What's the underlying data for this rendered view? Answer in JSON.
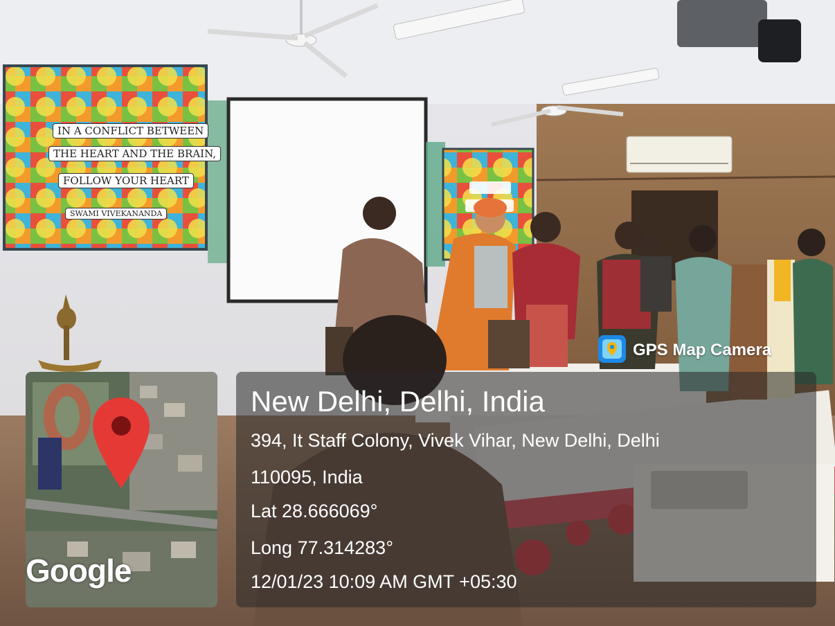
{
  "photo": {
    "poster_left_lines": [
      "IN A CONFLICT BETWEEN",
      "THE HEART AND THE BRAIN,",
      "FOLLOW YOUR HEART"
    ],
    "poster_left_author": "SWAMI VIVEKANANDA"
  },
  "brand": {
    "label": "GPS Map Camera",
    "icon": "gps-map-camera-app-icon",
    "icon_color": "#1e88e5"
  },
  "location": {
    "city": "New Delhi, Delhi, India",
    "address_line1": "394, It Staff Colony, Vivek Vihar, New Delhi, Delhi",
    "address_line2": "110095, India",
    "latitude": "Lat 28.666069°",
    "longitude": "Long 77.314283°",
    "timestamp": "12/01/23 10:09 AM GMT +05:30"
  },
  "map": {
    "provider": "Google",
    "marker_icon": "map-pin-icon",
    "marker_color": "#e53935"
  }
}
